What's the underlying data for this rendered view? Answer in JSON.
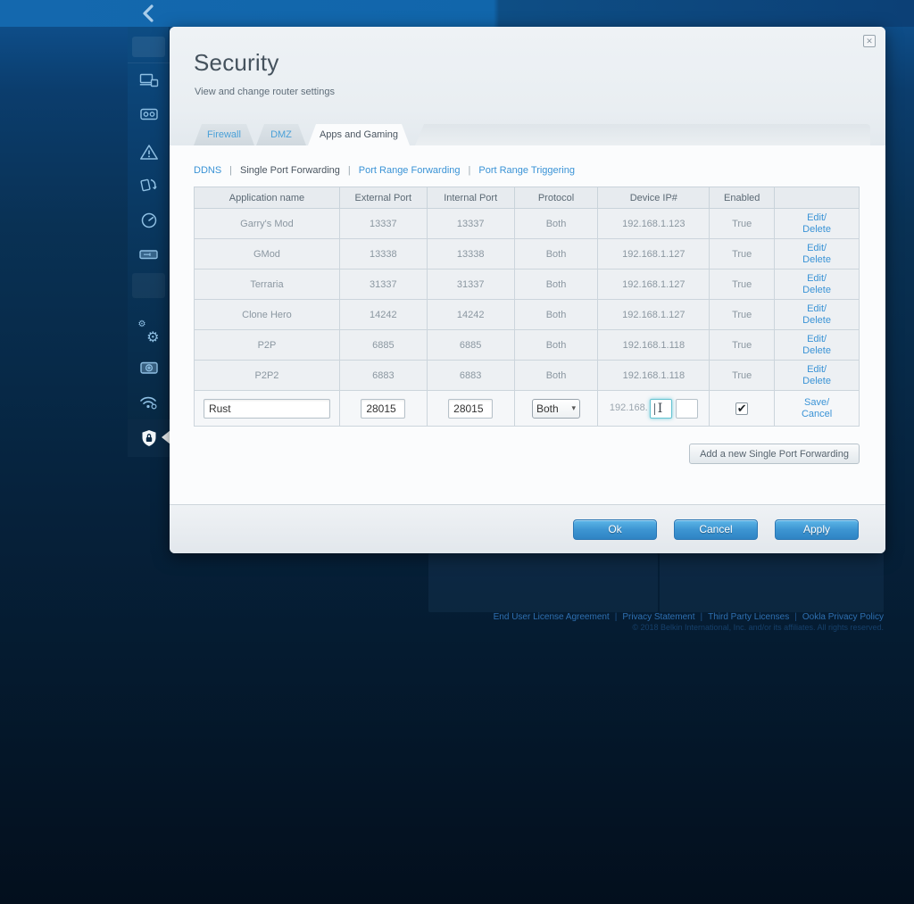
{
  "topbar": {
    "back_icon": "chevron-left"
  },
  "sidebar": {
    "icons": [
      "devices",
      "media-storage",
      "alerts",
      "media-prioritization",
      "speed-test",
      "external-storage",
      "settings",
      "troubleshooting",
      "wireless",
      "security"
    ]
  },
  "dialog": {
    "title": "Security",
    "subtitle": "View and change router settings",
    "tabs": [
      {
        "label": "Firewall",
        "active": false
      },
      {
        "label": "DMZ",
        "active": false
      },
      {
        "label": "Apps and Gaming",
        "active": true
      }
    ],
    "subnav": {
      "ddns": "DDNS",
      "single_port": "Single Port Forwarding",
      "port_range_fwd": "Port Range Forwarding",
      "port_range_trig": "Port Range Triggering"
    },
    "table": {
      "columns": [
        "Application name",
        "External Port",
        "Internal Port",
        "Protocol",
        "Device IP#",
        "Enabled",
        ""
      ],
      "rows": [
        {
          "app": "Garry's Mod",
          "external": "13337",
          "internal": "13337",
          "protocol": "Both",
          "ip": "192.168.1.123",
          "enabled": "True"
        },
        {
          "app": "GMod",
          "external": "13338",
          "internal": "13338",
          "protocol": "Both",
          "ip": "192.168.1.127",
          "enabled": "True"
        },
        {
          "app": "Terraria",
          "external": "31337",
          "internal": "31337",
          "protocol": "Both",
          "ip": "192.168.1.127",
          "enabled": "True"
        },
        {
          "app": "Clone Hero",
          "external": "14242",
          "internal": "14242",
          "protocol": "Both",
          "ip": "192.168.1.127",
          "enabled": "True"
        },
        {
          "app": "P2P",
          "external": "6885",
          "internal": "6885",
          "protocol": "Both",
          "ip": "192.168.1.118",
          "enabled": "True"
        },
        {
          "app": "P2P2",
          "external": "6883",
          "internal": "6883",
          "protocol": "Both",
          "ip": "192.168.1.118",
          "enabled": "True"
        }
      ],
      "row_actions": {
        "edit": "Edit/",
        "delete": "Delete"
      },
      "edit_row": {
        "application_value": "Rust",
        "external_value": "28015",
        "internal_value": "28015",
        "protocol_value": "Both",
        "ip_prefix": "192.168.",
        "ip_octet3_value": "",
        "ip_octet4_value": "",
        "enabled_checked": true,
        "save": "Save/",
        "cancel": "Cancel"
      }
    },
    "add_button": "Add a new Single Port Forwarding",
    "buttons": {
      "ok": "Ok",
      "cancel": "Cancel",
      "apply": "Apply"
    }
  },
  "page_footer": {
    "links": [
      "End User License Agreement",
      "Privacy Statement",
      "Third Party Licenses",
      "Ookla Privacy Policy"
    ],
    "copyright": "© 2018 Belkin International, Inc. and/or its affiliates. All rights reserved."
  },
  "glyphs": {
    "check": "✔",
    "chevron_down": "▾",
    "close": "✕",
    "gear": "⚙"
  },
  "colors": {
    "accent_blue": "#3a93d6",
    "button_blue": "#3d95d2",
    "topbar_blue": "#1166ab",
    "dialog_bg": "#fbfcfd"
  }
}
